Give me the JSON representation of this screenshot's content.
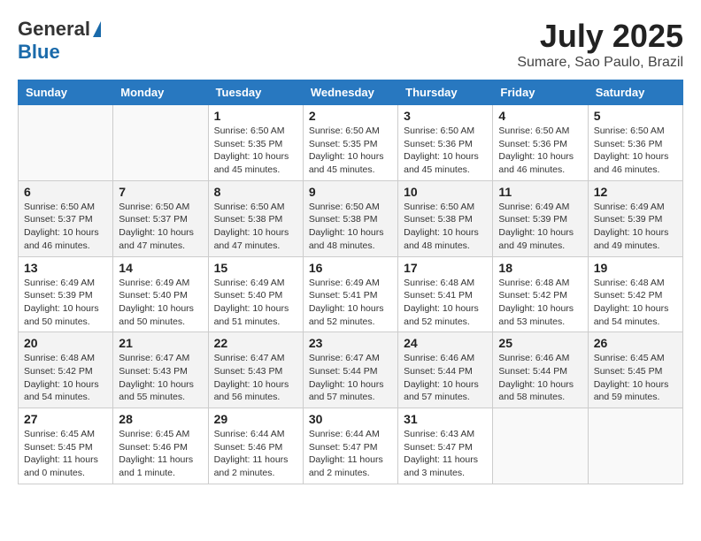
{
  "header": {
    "logo_line1": "General",
    "logo_line2": "Blue",
    "month": "July 2025",
    "location": "Sumare, Sao Paulo, Brazil"
  },
  "days_of_week": [
    "Sunday",
    "Monday",
    "Tuesday",
    "Wednesday",
    "Thursday",
    "Friday",
    "Saturday"
  ],
  "weeks": [
    [
      {
        "day": "",
        "info": ""
      },
      {
        "day": "",
        "info": ""
      },
      {
        "day": "1",
        "info": "Sunrise: 6:50 AM\nSunset: 5:35 PM\nDaylight: 10 hours and 45 minutes."
      },
      {
        "day": "2",
        "info": "Sunrise: 6:50 AM\nSunset: 5:35 PM\nDaylight: 10 hours and 45 minutes."
      },
      {
        "day": "3",
        "info": "Sunrise: 6:50 AM\nSunset: 5:36 PM\nDaylight: 10 hours and 45 minutes."
      },
      {
        "day": "4",
        "info": "Sunrise: 6:50 AM\nSunset: 5:36 PM\nDaylight: 10 hours and 46 minutes."
      },
      {
        "day": "5",
        "info": "Sunrise: 6:50 AM\nSunset: 5:36 PM\nDaylight: 10 hours and 46 minutes."
      }
    ],
    [
      {
        "day": "6",
        "info": "Sunrise: 6:50 AM\nSunset: 5:37 PM\nDaylight: 10 hours and 46 minutes."
      },
      {
        "day": "7",
        "info": "Sunrise: 6:50 AM\nSunset: 5:37 PM\nDaylight: 10 hours and 47 minutes."
      },
      {
        "day": "8",
        "info": "Sunrise: 6:50 AM\nSunset: 5:38 PM\nDaylight: 10 hours and 47 minutes."
      },
      {
        "day": "9",
        "info": "Sunrise: 6:50 AM\nSunset: 5:38 PM\nDaylight: 10 hours and 48 minutes."
      },
      {
        "day": "10",
        "info": "Sunrise: 6:50 AM\nSunset: 5:38 PM\nDaylight: 10 hours and 48 minutes."
      },
      {
        "day": "11",
        "info": "Sunrise: 6:49 AM\nSunset: 5:39 PM\nDaylight: 10 hours and 49 minutes."
      },
      {
        "day": "12",
        "info": "Sunrise: 6:49 AM\nSunset: 5:39 PM\nDaylight: 10 hours and 49 minutes."
      }
    ],
    [
      {
        "day": "13",
        "info": "Sunrise: 6:49 AM\nSunset: 5:39 PM\nDaylight: 10 hours and 50 minutes."
      },
      {
        "day": "14",
        "info": "Sunrise: 6:49 AM\nSunset: 5:40 PM\nDaylight: 10 hours and 50 minutes."
      },
      {
        "day": "15",
        "info": "Sunrise: 6:49 AM\nSunset: 5:40 PM\nDaylight: 10 hours and 51 minutes."
      },
      {
        "day": "16",
        "info": "Sunrise: 6:49 AM\nSunset: 5:41 PM\nDaylight: 10 hours and 52 minutes."
      },
      {
        "day": "17",
        "info": "Sunrise: 6:48 AM\nSunset: 5:41 PM\nDaylight: 10 hours and 52 minutes."
      },
      {
        "day": "18",
        "info": "Sunrise: 6:48 AM\nSunset: 5:42 PM\nDaylight: 10 hours and 53 minutes."
      },
      {
        "day": "19",
        "info": "Sunrise: 6:48 AM\nSunset: 5:42 PM\nDaylight: 10 hours and 54 minutes."
      }
    ],
    [
      {
        "day": "20",
        "info": "Sunrise: 6:48 AM\nSunset: 5:42 PM\nDaylight: 10 hours and 54 minutes."
      },
      {
        "day": "21",
        "info": "Sunrise: 6:47 AM\nSunset: 5:43 PM\nDaylight: 10 hours and 55 minutes."
      },
      {
        "day": "22",
        "info": "Sunrise: 6:47 AM\nSunset: 5:43 PM\nDaylight: 10 hours and 56 minutes."
      },
      {
        "day": "23",
        "info": "Sunrise: 6:47 AM\nSunset: 5:44 PM\nDaylight: 10 hours and 57 minutes."
      },
      {
        "day": "24",
        "info": "Sunrise: 6:46 AM\nSunset: 5:44 PM\nDaylight: 10 hours and 57 minutes."
      },
      {
        "day": "25",
        "info": "Sunrise: 6:46 AM\nSunset: 5:44 PM\nDaylight: 10 hours and 58 minutes."
      },
      {
        "day": "26",
        "info": "Sunrise: 6:45 AM\nSunset: 5:45 PM\nDaylight: 10 hours and 59 minutes."
      }
    ],
    [
      {
        "day": "27",
        "info": "Sunrise: 6:45 AM\nSunset: 5:45 PM\nDaylight: 11 hours and 0 minutes."
      },
      {
        "day": "28",
        "info": "Sunrise: 6:45 AM\nSunset: 5:46 PM\nDaylight: 11 hours and 1 minute."
      },
      {
        "day": "29",
        "info": "Sunrise: 6:44 AM\nSunset: 5:46 PM\nDaylight: 11 hours and 2 minutes."
      },
      {
        "day": "30",
        "info": "Sunrise: 6:44 AM\nSunset: 5:47 PM\nDaylight: 11 hours and 2 minutes."
      },
      {
        "day": "31",
        "info": "Sunrise: 6:43 AM\nSunset: 5:47 PM\nDaylight: 11 hours and 3 minutes."
      },
      {
        "day": "",
        "info": ""
      },
      {
        "day": "",
        "info": ""
      }
    ]
  ]
}
